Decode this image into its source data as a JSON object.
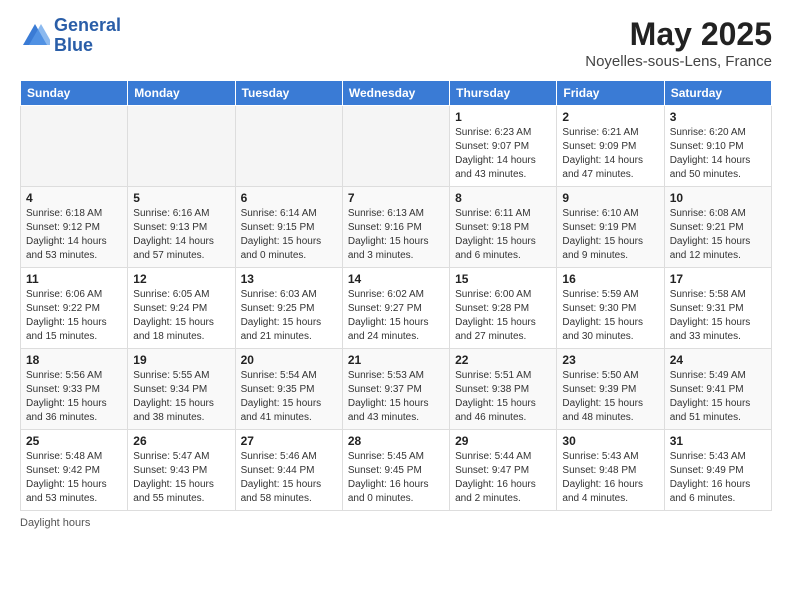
{
  "header": {
    "logo_line1": "General",
    "logo_line2": "Blue",
    "month_title": "May 2025",
    "location": "Noyelles-sous-Lens, France"
  },
  "weekdays": [
    "Sunday",
    "Monday",
    "Tuesday",
    "Wednesday",
    "Thursday",
    "Friday",
    "Saturday"
  ],
  "footer": {
    "label": "Daylight hours"
  },
  "weeks": [
    [
      {
        "day": "",
        "info": ""
      },
      {
        "day": "",
        "info": ""
      },
      {
        "day": "",
        "info": ""
      },
      {
        "day": "",
        "info": ""
      },
      {
        "day": "1",
        "info": "Sunrise: 6:23 AM\nSunset: 9:07 PM\nDaylight: 14 hours\nand 43 minutes."
      },
      {
        "day": "2",
        "info": "Sunrise: 6:21 AM\nSunset: 9:09 PM\nDaylight: 14 hours\nand 47 minutes."
      },
      {
        "day": "3",
        "info": "Sunrise: 6:20 AM\nSunset: 9:10 PM\nDaylight: 14 hours\nand 50 minutes."
      }
    ],
    [
      {
        "day": "4",
        "info": "Sunrise: 6:18 AM\nSunset: 9:12 PM\nDaylight: 14 hours\nand 53 minutes."
      },
      {
        "day": "5",
        "info": "Sunrise: 6:16 AM\nSunset: 9:13 PM\nDaylight: 14 hours\nand 57 minutes."
      },
      {
        "day": "6",
        "info": "Sunrise: 6:14 AM\nSunset: 9:15 PM\nDaylight: 15 hours\nand 0 minutes."
      },
      {
        "day": "7",
        "info": "Sunrise: 6:13 AM\nSunset: 9:16 PM\nDaylight: 15 hours\nand 3 minutes."
      },
      {
        "day": "8",
        "info": "Sunrise: 6:11 AM\nSunset: 9:18 PM\nDaylight: 15 hours\nand 6 minutes."
      },
      {
        "day": "9",
        "info": "Sunrise: 6:10 AM\nSunset: 9:19 PM\nDaylight: 15 hours\nand 9 minutes."
      },
      {
        "day": "10",
        "info": "Sunrise: 6:08 AM\nSunset: 9:21 PM\nDaylight: 15 hours\nand 12 minutes."
      }
    ],
    [
      {
        "day": "11",
        "info": "Sunrise: 6:06 AM\nSunset: 9:22 PM\nDaylight: 15 hours\nand 15 minutes."
      },
      {
        "day": "12",
        "info": "Sunrise: 6:05 AM\nSunset: 9:24 PM\nDaylight: 15 hours\nand 18 minutes."
      },
      {
        "day": "13",
        "info": "Sunrise: 6:03 AM\nSunset: 9:25 PM\nDaylight: 15 hours\nand 21 minutes."
      },
      {
        "day": "14",
        "info": "Sunrise: 6:02 AM\nSunset: 9:27 PM\nDaylight: 15 hours\nand 24 minutes."
      },
      {
        "day": "15",
        "info": "Sunrise: 6:00 AM\nSunset: 9:28 PM\nDaylight: 15 hours\nand 27 minutes."
      },
      {
        "day": "16",
        "info": "Sunrise: 5:59 AM\nSunset: 9:30 PM\nDaylight: 15 hours\nand 30 minutes."
      },
      {
        "day": "17",
        "info": "Sunrise: 5:58 AM\nSunset: 9:31 PM\nDaylight: 15 hours\nand 33 minutes."
      }
    ],
    [
      {
        "day": "18",
        "info": "Sunrise: 5:56 AM\nSunset: 9:33 PM\nDaylight: 15 hours\nand 36 minutes."
      },
      {
        "day": "19",
        "info": "Sunrise: 5:55 AM\nSunset: 9:34 PM\nDaylight: 15 hours\nand 38 minutes."
      },
      {
        "day": "20",
        "info": "Sunrise: 5:54 AM\nSunset: 9:35 PM\nDaylight: 15 hours\nand 41 minutes."
      },
      {
        "day": "21",
        "info": "Sunrise: 5:53 AM\nSunset: 9:37 PM\nDaylight: 15 hours\nand 43 minutes."
      },
      {
        "day": "22",
        "info": "Sunrise: 5:51 AM\nSunset: 9:38 PM\nDaylight: 15 hours\nand 46 minutes."
      },
      {
        "day": "23",
        "info": "Sunrise: 5:50 AM\nSunset: 9:39 PM\nDaylight: 15 hours\nand 48 minutes."
      },
      {
        "day": "24",
        "info": "Sunrise: 5:49 AM\nSunset: 9:41 PM\nDaylight: 15 hours\nand 51 minutes."
      }
    ],
    [
      {
        "day": "25",
        "info": "Sunrise: 5:48 AM\nSunset: 9:42 PM\nDaylight: 15 hours\nand 53 minutes."
      },
      {
        "day": "26",
        "info": "Sunrise: 5:47 AM\nSunset: 9:43 PM\nDaylight: 15 hours\nand 55 minutes."
      },
      {
        "day": "27",
        "info": "Sunrise: 5:46 AM\nSunset: 9:44 PM\nDaylight: 15 hours\nand 58 minutes."
      },
      {
        "day": "28",
        "info": "Sunrise: 5:45 AM\nSunset: 9:45 PM\nDaylight: 16 hours\nand 0 minutes."
      },
      {
        "day": "29",
        "info": "Sunrise: 5:44 AM\nSunset: 9:47 PM\nDaylight: 16 hours\nand 2 minutes."
      },
      {
        "day": "30",
        "info": "Sunrise: 5:43 AM\nSunset: 9:48 PM\nDaylight: 16 hours\nand 4 minutes."
      },
      {
        "day": "31",
        "info": "Sunrise: 5:43 AM\nSunset: 9:49 PM\nDaylight: 16 hours\nand 6 minutes."
      }
    ]
  ]
}
